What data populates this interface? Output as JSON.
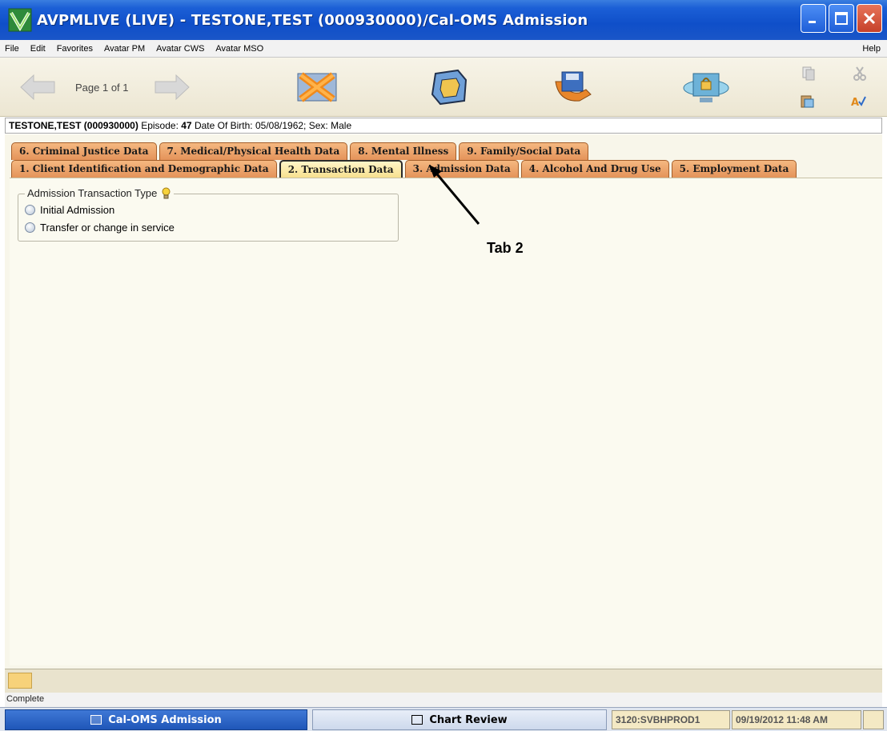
{
  "window": {
    "title": "AVPMLIVE (LIVE) - TESTONE,TEST (000930000)/Cal-OMS Admission",
    "minimize_icon": "minimize-icon",
    "maximize_icon": "maximize-icon",
    "close_icon": "close-icon"
  },
  "menu": {
    "items": [
      "File",
      "Edit",
      "Favorites",
      "Avatar PM",
      "Avatar CWS",
      "Avatar MSO"
    ],
    "help": "Help"
  },
  "toolbar": {
    "page_label": "Page 1 of 1",
    "icons": [
      "back-arrow-icon",
      "forward-arrow-icon",
      "discard-icon",
      "submit-icon",
      "save-icon",
      "lock-icon",
      "copy-icon",
      "cut-icon",
      "paste-icon",
      "spellcheck-icon"
    ]
  },
  "client": {
    "name": "TESTONE,TEST (000930000)",
    "episode_label": "Episode:",
    "episode": "47",
    "dob_label": "Date Of Birth:",
    "dob": "05/08/1962;",
    "sex_label": "Sex:",
    "sex": "Male"
  },
  "tabs": {
    "back_row": [
      "6. Criminal Justice Data",
      "7. Medical/Physical Health Data",
      "8. Mental Illness",
      "9. Family/Social Data"
    ],
    "front_row": [
      "1. Client Identification and Demographic Data",
      "2. Transaction Data",
      "3. Admission Data",
      "4. Alcohol And Drug Use",
      "5. Employment Data"
    ],
    "active": "2. Transaction Data"
  },
  "form": {
    "group_label": "Admission Transaction Type",
    "options": [
      "Initial Admission",
      "Transfer or change in service"
    ]
  },
  "annotation": {
    "label": "Tab 2"
  },
  "status": {
    "text": "Complete"
  },
  "taskbar": {
    "active": "Cal-OMS Admission",
    "inactive": "Chart Review",
    "server": "3120:SVBHPROD1",
    "datetime": "09/19/2012 11:48 AM"
  }
}
